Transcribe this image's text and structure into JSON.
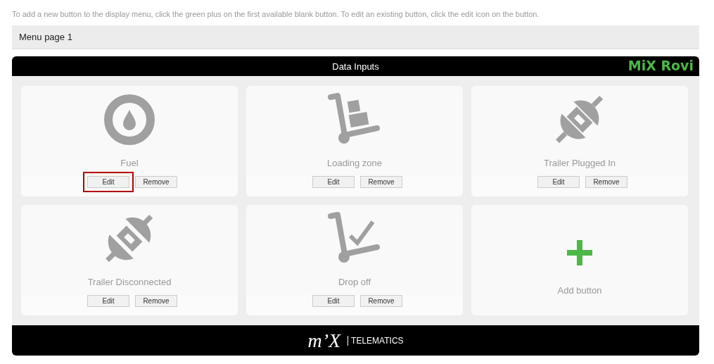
{
  "instructions": "To add a new button to the display menu, click the green plus on the first available blank button. To edit an existing button, click the edit icon on the button.",
  "menu_page": {
    "title": "Menu page 1"
  },
  "panel": {
    "title": "Data Inputs",
    "brand": "MiX Rovi"
  },
  "cards": [
    {
      "kind": "drop",
      "label": "Fuel",
      "actions": [
        {
          "label": "Edit",
          "highlighted": true
        },
        {
          "label": "Remove",
          "highlighted": false
        }
      ]
    },
    {
      "kind": "trolley",
      "label": "Loading zone",
      "actions": [
        {
          "label": "Edit",
          "highlighted": false
        },
        {
          "label": "Remove",
          "highlighted": false
        }
      ]
    },
    {
      "kind": "plug",
      "label": "Trailer Plugged In",
      "actions": [
        {
          "label": "Edit",
          "highlighted": false
        },
        {
          "label": "Remove",
          "highlighted": false
        }
      ]
    },
    {
      "kind": "unplug",
      "label": "Trailer Disconnected",
      "actions": [
        {
          "label": "Edit",
          "highlighted": false
        },
        {
          "label": "Remove",
          "highlighted": false
        }
      ]
    },
    {
      "kind": "dropoff",
      "label": "Drop off",
      "actions": [
        {
          "label": "Edit",
          "highlighted": false
        },
        {
          "label": "Remove",
          "highlighted": false
        }
      ]
    },
    {
      "kind": "add",
      "label": "Add button"
    }
  ],
  "footer": {
    "logo_mark": "m’X",
    "logo_text": "TELEMATICS"
  }
}
